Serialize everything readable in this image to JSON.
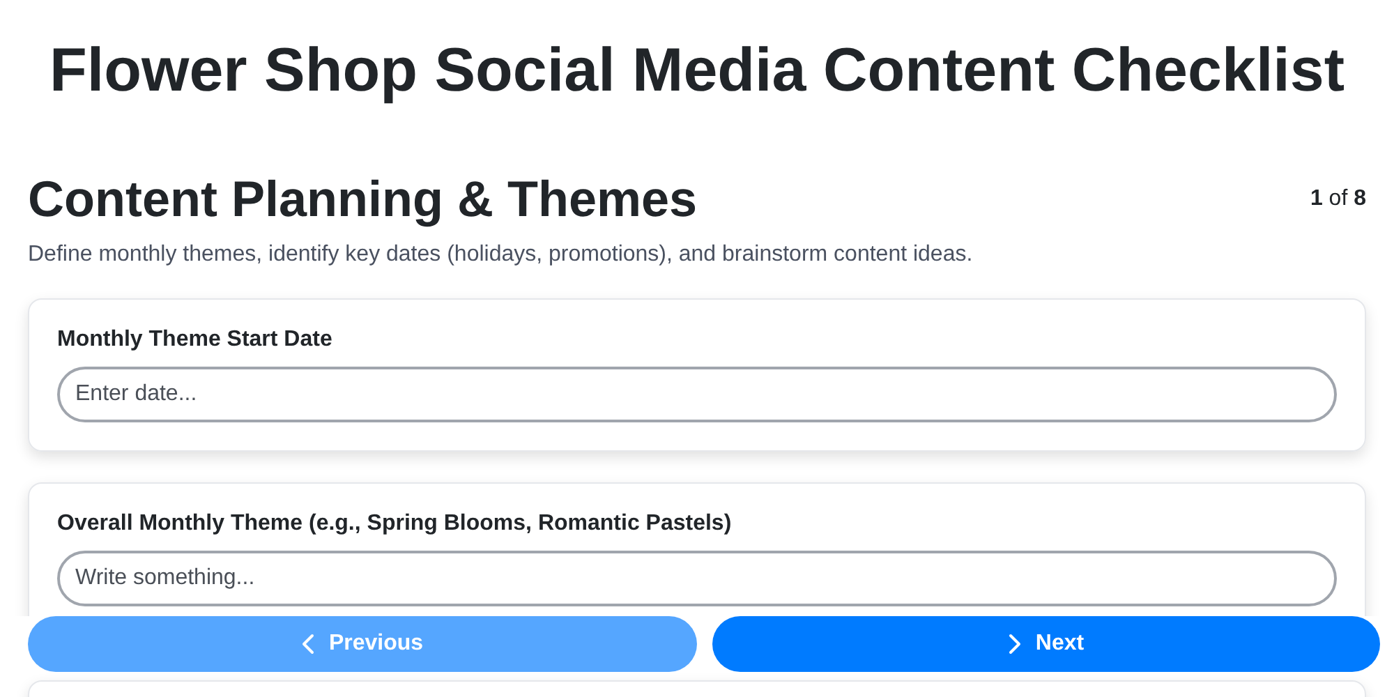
{
  "title": "Flower Shop Social Media Content Checklist",
  "section": {
    "heading": "Content Planning & Themes",
    "page_indicator": "**1** of **8**",
    "description": "Define monthly themes, identify key dates (holidays, promotions), and brainstorm content ideas."
  },
  "fields": [
    {
      "label": "Monthly Theme Start Date",
      "placeholder": "Enter date..."
    },
    {
      "label": "Overall Monthly Theme (e.g., Spring Blooms, Romantic Pastels)",
      "placeholder": "Write something..."
    }
  ],
  "navigation": [
    {
      "label": "Previous",
      "kind": "prev",
      "disabled": true
    },
    {
      "label": "Next",
      "kind": "next",
      "disabled": false
    }
  ]
}
